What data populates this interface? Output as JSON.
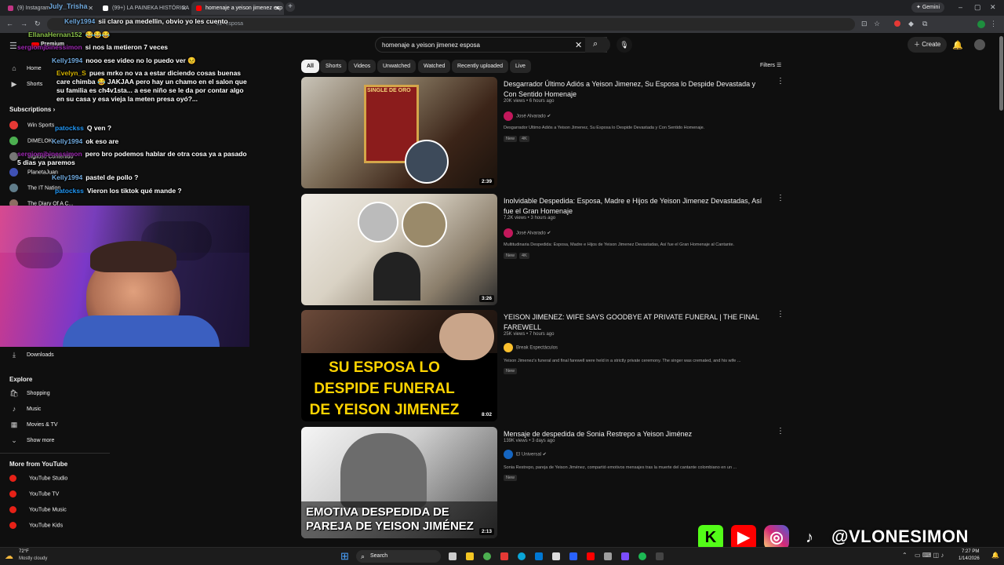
{
  "browser": {
    "tabs": [
      {
        "label": "(9) Instagram",
        "color": "#c13584"
      },
      {
        "label": "(99+) LA PAINEKA HISTÓRICA",
        "color": "#ffffff"
      },
      {
        "label": "homenaje a yeison jimenez esp",
        "color": "#ff0000"
      }
    ],
    "stream_user": "July_Trisha",
    "stream_msg": "sii claro pa medellin, obvio yo les cuento",
    "gemini": "Gemini",
    "url_fragment": "ez+esposa",
    "new_tab": "+"
  },
  "youtube": {
    "premium": "Premium",
    "search_value": "homenaje a yeison jimenez esposa",
    "create": "Create",
    "filters_label": "Filters",
    "chips": [
      "All",
      "Shorts",
      "Videos",
      "Unwatched",
      "Watched",
      "Recently uploaded",
      "Live"
    ]
  },
  "sidebar": {
    "home": "Home",
    "shorts": "Shorts",
    "subscriptions": "Subscriptions",
    "subs": [
      "Win Sports",
      "DIMELOKI",
      "Sigiloso Contenido",
      "PlanetaJuan",
      "The IT Nation",
      "The Diary Of A C..."
    ],
    "downloads": "Downloads",
    "explore": "Explore",
    "explore_items": [
      "Shopping",
      "Music",
      "Movies & TV",
      "Show more"
    ],
    "more_from": "More from YouTube",
    "more_items": [
      "YouTube Studio",
      "YouTube TV",
      "YouTube Music",
      "YouTube Kids"
    ]
  },
  "chat": [
    {
      "user": "Kelly1994",
      "color": "#6fa8dc",
      "text": "sii claro pa medellin, obvio yo les cuento"
    },
    {
      "user": "EllanaHernan152",
      "color": "#8bc34a",
      "text": "😂😂😂"
    },
    {
      "user": "sergiomjbinessimon",
      "color": "#9c27b0",
      "text": "si nos la metieron 7 veces"
    },
    {
      "user": "Kelly1994",
      "color": "#6fa8dc",
      "text": "nooo ese video no lo puedo ver 😣"
    },
    {
      "user": "Evelyn_S",
      "color": "#d4b200",
      "text": "pues mrko no va a estar diciendo cosas buenas care chimba 😂 JAKJAA pero hay un chamo en el salon que su familia es ch4v1sta... a ese niño se le da por contar algo en su casa y esa vieja la meten presa oyó?..."
    },
    {
      "user": "patockss",
      "color": "#2196f3",
      "text": "Q ven ?"
    },
    {
      "user": "Kelly1994",
      "color": "#6fa8dc",
      "text": "ok eso are"
    },
    {
      "user": "sergiomjbinessimon",
      "color": "#9c27b0",
      "text": "pero bro podemos hablar de otra cosa ya a pasado 5 dias ya paremos"
    },
    {
      "user": "Kelly1994",
      "color": "#6fa8dc",
      "text": "pastel de pollo ?"
    },
    {
      "user": "patockss",
      "color": "#2196f3",
      "text": "Vieron los tiktok qué mande ?"
    }
  ],
  "videos": [
    {
      "title": "Desgarrador Último Adiós a Yeison Jimenez, Su Esposa lo Despide Devastada y Con Sentido Homenaje",
      "meta": "20K views • 6 hours ago",
      "channel": "José Alvarado",
      "desc": "Desgarrador Último Adiós a Yeison Jimenez, Su Esposa lo Despide Devastada y Con Sentido Homenaje.",
      "badges": [
        "New",
        "4K"
      ],
      "duration": "2:39",
      "overlay": "SINGLE DE ORO"
    },
    {
      "title": "Inolvidable Despedida: Esposa, Madre e Hijos de Yeison Jimenez Devastadas, Así fue el Gran Homenaje",
      "meta": "7.2K views • 3 hours ago",
      "channel": "José Alvarado",
      "desc": "Multitudinaria Despedida: Esposa, Madre e Hijos de Yeison Jimenez Devastadas, Así fue el Gran Homenaje al Cantante.",
      "badges": [
        "New",
        "4K"
      ],
      "duration": "3:26",
      "overlay": ""
    },
    {
      "title": "YEISON JIMENEZ: WIFE SAYS GOODBYE AT PRIVATE FUNERAL | THE FINAL FAREWELL",
      "meta": "25K views • 7 hours ago",
      "channel": "Break Espectáculos",
      "desc": "Yeison Jimenez's funeral and final farewell were held in a strictly private ceremony. The singer was cremated, and his wife ...",
      "badges": [
        "New"
      ],
      "duration": "8:02",
      "overlay": "SU ESPOSA LO DESPIDE FUNERAL DE YEISON JIMENEZ"
    },
    {
      "title": "Mensaje de despedida de Sonia Restrepo a Yeison Jiménez",
      "meta": "139K views • 3 days ago",
      "channel": "El Universal",
      "desc": "Sonia Restrepo, pareja de Yeison Jiménez, compartió emotivos mensajes tras la muerte del cantante colombiano en un ...",
      "badges": [
        "New"
      ],
      "duration": "2:13",
      "overlay": "EMOTIVA DESPEDIDA DE PAREJA DE YEISON JIMÉNEZ"
    }
  ],
  "social": {
    "handle": "@VLONESIMON"
  },
  "taskbar": {
    "temp": "72°F",
    "weather": "Mostly cloudy",
    "search": "Search",
    "time": "7:27 PM",
    "date": "1/14/2026"
  }
}
